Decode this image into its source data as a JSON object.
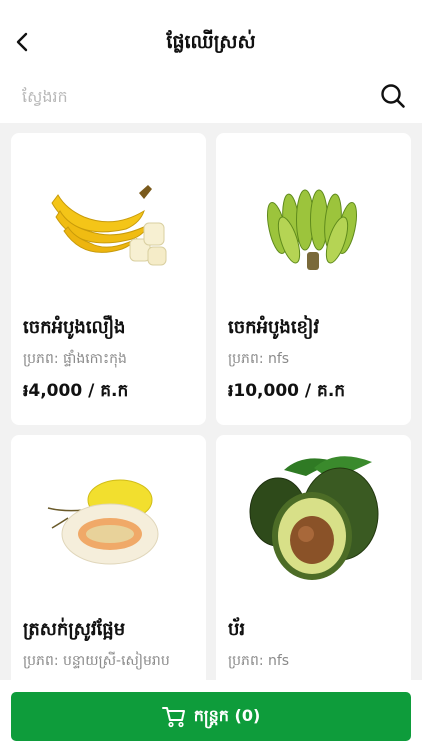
{
  "header": {
    "title": "ផ្លែឈើស្រស់",
    "back_icon": "chevron-left-icon"
  },
  "search": {
    "placeholder": "ស្វែងរក",
    "value": "",
    "icon": "search-icon"
  },
  "products": [
    {
      "name": "ចេកអំបូងលឿង",
      "source": "ប្រភព: ផ្ទាំងកោះកុង",
      "price": "៛4,000 / គ.ក",
      "image_icon": "banana-yellow-icon"
    },
    {
      "name": "ចេកអំបូងខៀវ",
      "source": "ប្រភព: nfs",
      "price": "៛10,000 / គ.ក",
      "image_icon": "banana-green-icon"
    },
    {
      "name": "ត្រសក់ស្រូវផ្អែម",
      "source": "ប្រភព: បន្ទាយស្រី-សៀមរាប",
      "price": "",
      "image_icon": "melon-icon"
    },
    {
      "name": "ប័រ",
      "source": "ប្រភព: nfs",
      "price": "",
      "image_icon": "avocado-icon"
    }
  ],
  "cart": {
    "label": "កន្ត្រក (0)",
    "icon": "cart-icon"
  },
  "colors": {
    "accent": "#0e9c3b",
    "background": "#f2f2f2"
  }
}
